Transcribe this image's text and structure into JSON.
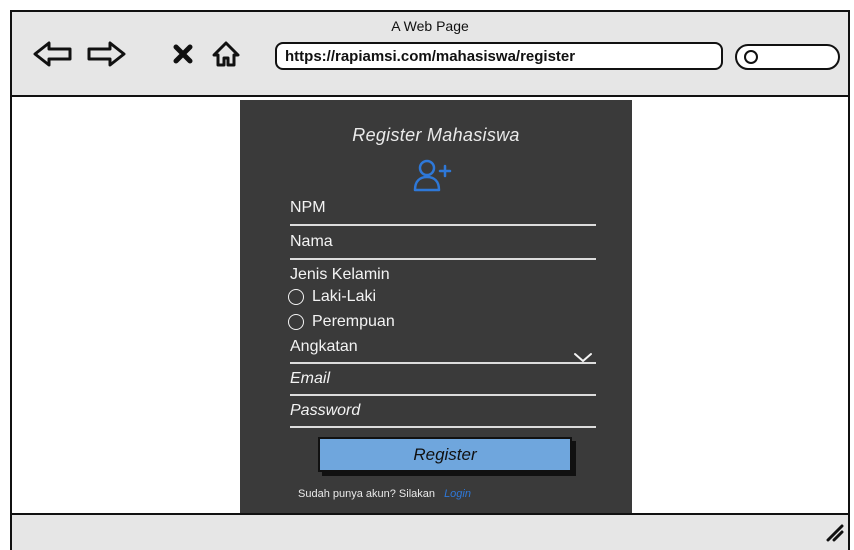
{
  "browser": {
    "title": "A Web Page",
    "url": "https://rapiamsi.com/mahasiswa/register",
    "icons": {
      "back": "back-arrow-icon",
      "forward": "forward-arrow-icon",
      "close": "close-icon",
      "home": "home-icon",
      "search": "search-icon"
    }
  },
  "form": {
    "title": "Register Mahasiswa",
    "icon": "user-plus-icon",
    "fields": {
      "npm": "NPM",
      "nama": "Nama",
      "jenis_kelamin": "Jenis Kelamin",
      "angkatan": "Angkatan",
      "email": "Email",
      "password": "Password"
    },
    "gender_options": {
      "male": "Laki-Laki",
      "female": "Perempuan"
    },
    "register_button": "Register",
    "footer": {
      "text": "Sudah punya akun? Silakan",
      "login_link": "Login"
    }
  },
  "colors": {
    "card_background": "#3a3a3a",
    "accent_blue": "#2e78d8",
    "button_blue": "#6fa6dd"
  }
}
